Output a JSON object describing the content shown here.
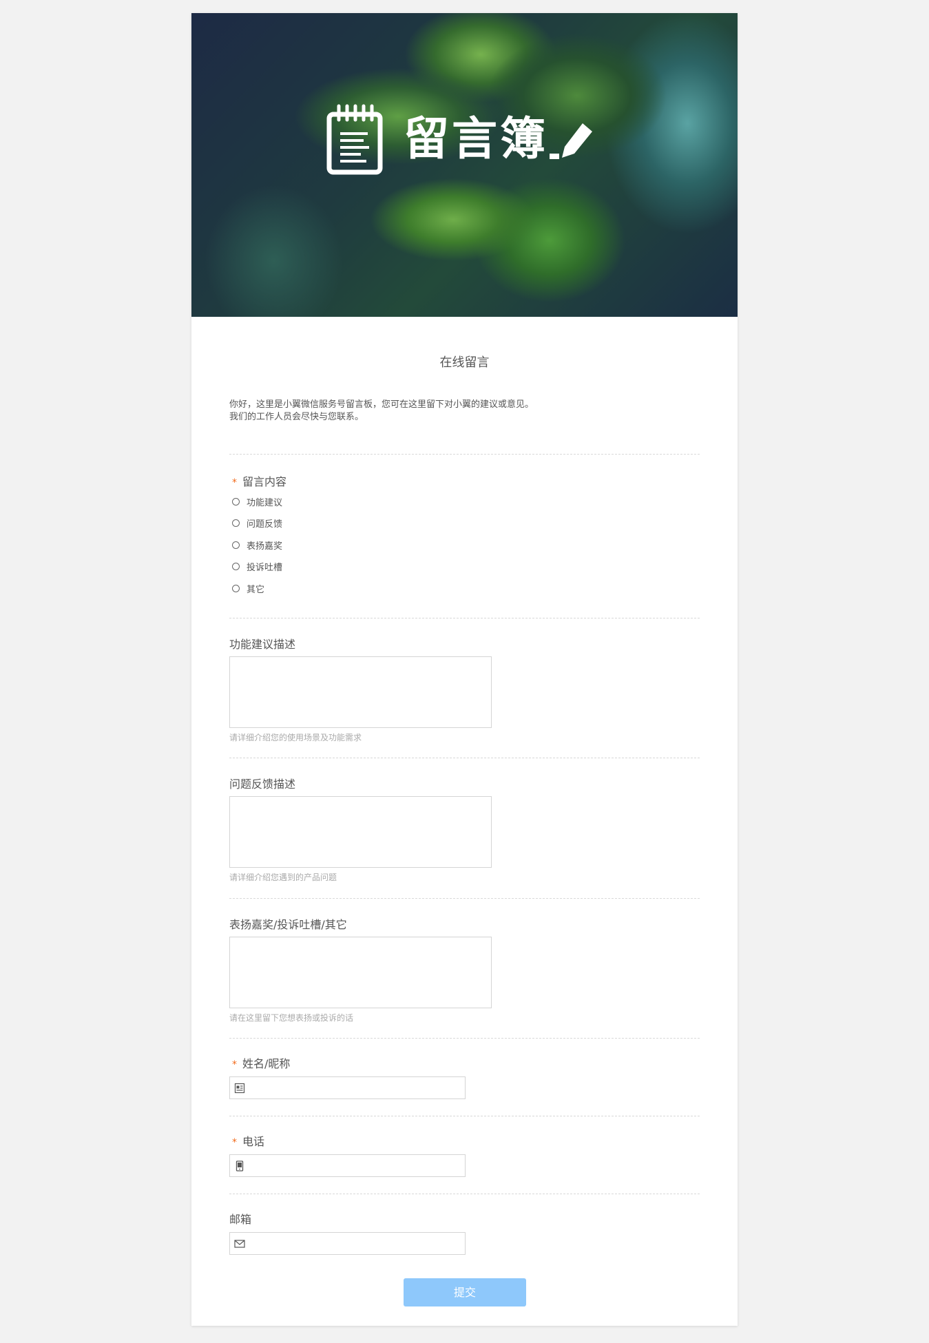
{
  "banner": {
    "title": "留言簿",
    "icons": [
      "notepad-icon",
      "pen-icon"
    ]
  },
  "form": {
    "title": "在线留言",
    "intro_line1": "你好，这里是小翼微信服务号留言板，您可在这里留下对小翼的建议或意见。",
    "intro_line2": "我们的工作人员会尽快与您联系。",
    "required_mark": "*",
    "message_type": {
      "label": "留言内容",
      "required": true,
      "options": [
        "功能建议",
        "问题反馈",
        "表扬嘉奖",
        "投诉吐槽",
        "其它"
      ]
    },
    "feature_desc": {
      "label": "功能建议描述",
      "hint": "请详细介绍您的使用场景及功能需求",
      "value": ""
    },
    "issue_desc": {
      "label": "问题反馈描述",
      "hint": "请详细介绍您遇到的产品问题",
      "value": ""
    },
    "other_desc": {
      "label": "表扬嘉奖/投诉吐槽/其它",
      "hint": "请在这里留下您想表扬或投诉的话",
      "value": ""
    },
    "name": {
      "label": "姓名/昵称",
      "required": true,
      "value": "",
      "icon": "id-card-icon"
    },
    "phone": {
      "label": "电话",
      "required": true,
      "value": "",
      "icon": "phone-icon"
    },
    "email": {
      "label": "邮箱",
      "required": false,
      "value": "",
      "icon": "mail-icon"
    },
    "submit_label": "提交"
  },
  "colors": {
    "page_bg": "#f2f2f2",
    "required": "#f26a1b",
    "submit_bg": "#8ec8fb",
    "border": "#d4d4d4"
  }
}
